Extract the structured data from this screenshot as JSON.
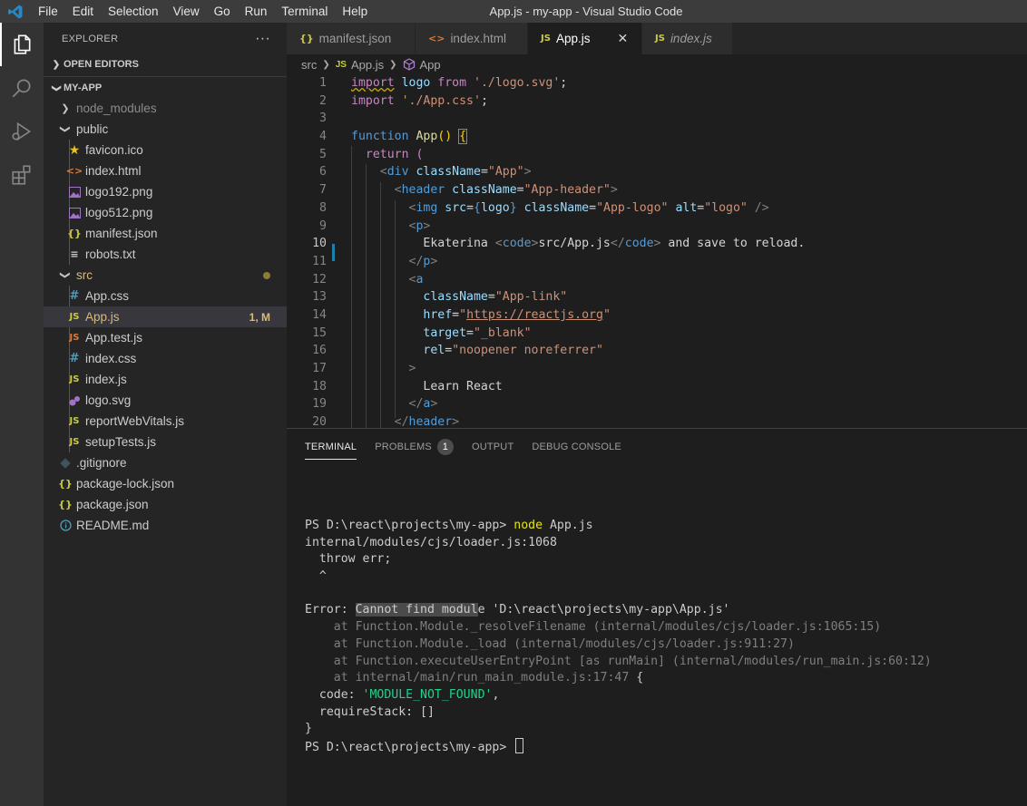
{
  "titlebar": {
    "menu": [
      "File",
      "Edit",
      "Selection",
      "View",
      "Go",
      "Run",
      "Terminal",
      "Help"
    ],
    "window_title": "App.js - my-app - Visual Studio Code"
  },
  "sidebar": {
    "title": "EXPLORER",
    "more": "···",
    "open_editors": "OPEN EDITORS",
    "project": "MY-APP",
    "items": [
      {
        "label": "node_modules",
        "icon": "chevron-right"
      },
      {
        "label": "public",
        "icon": "chevron-down"
      },
      {
        "label": "favicon.ico",
        "icon": "star-icon"
      },
      {
        "label": "index.html",
        "icon": "html-icon"
      },
      {
        "label": "logo192.png",
        "icon": "image-icon"
      },
      {
        "label": "logo512.png",
        "icon": "image-icon"
      },
      {
        "label": "manifest.json",
        "icon": "json-icon"
      },
      {
        "label": "robots.txt",
        "icon": "text-icon"
      },
      {
        "label": "src",
        "icon": "chevron-down"
      },
      {
        "label": "App.css",
        "icon": "css-icon"
      },
      {
        "label": "App.js",
        "icon": "js-icon",
        "badge": "1, M"
      },
      {
        "label": "App.test.js",
        "icon": "js-icon"
      },
      {
        "label": "index.css",
        "icon": "css-icon"
      },
      {
        "label": "index.js",
        "icon": "js-icon"
      },
      {
        "label": "logo.svg",
        "icon": "svg-icon"
      },
      {
        "label": "reportWebVitals.js",
        "icon": "js-icon"
      },
      {
        "label": "setupTests.js",
        "icon": "js-icon"
      },
      {
        "label": ".gitignore",
        "icon": "git-icon"
      },
      {
        "label": "package-lock.json",
        "icon": "json-icon"
      },
      {
        "label": "package.json",
        "icon": "json-icon"
      },
      {
        "label": "README.md",
        "icon": "info-icon"
      }
    ]
  },
  "tabs": [
    {
      "label": "manifest.json",
      "icon": "{}"
    },
    {
      "label": "index.html",
      "icon": "<>"
    },
    {
      "label": "App.js",
      "icon": "JS",
      "close": "✕"
    },
    {
      "label": "index.js",
      "icon": "JS"
    }
  ],
  "breadcrumb": {
    "folder": "src",
    "file": "App.js",
    "symbol": "App"
  },
  "code": {
    "line_numbers": [
      "1",
      "2",
      "3",
      "4",
      "5",
      "6",
      "7",
      "8",
      "9",
      "10",
      "11",
      "12",
      "13",
      "14",
      "15",
      "16",
      "17",
      "18",
      "19",
      "20"
    ],
    "l1": {
      "a": "import",
      "b": " ",
      "c": "logo",
      "d": " from ",
      "e": "'./logo.svg'",
      "f": ";"
    },
    "l2": {
      "a": "import",
      "b": " ",
      "c": "'./App.css'",
      "d": ";"
    },
    "l4": {
      "a": "function",
      "b": " ",
      "c": "App",
      "d": "()",
      "e": " ",
      "f": "{"
    },
    "l5": {
      "a": "  return",
      "b": " ("
    },
    "l6": {
      "a": "    <",
      "b": "div",
      "c": " ",
      "d": "className",
      "e": "=",
      "f": "\"App\"",
      "g": ">"
    },
    "l7": {
      "a": "      <",
      "b": "header",
      "c": " ",
      "d": "className",
      "e": "=",
      "f": "\"App-header\"",
      "g": ">"
    },
    "l8": {
      "a": "        <",
      "b": "img",
      "c": " ",
      "d": "src",
      "e": "=",
      "f": "{",
      "g": "logo",
      "h": "}",
      "i": " ",
      "j": "className",
      "k": "=",
      "l": "\"App-logo\"",
      "m": " ",
      "n": "alt",
      "o": "=",
      "p": "\"logo\"",
      "q": " />"
    },
    "l9": {
      "a": "        <",
      "b": "p",
      "c": ">"
    },
    "l10": {
      "a": "          Ekaterina ",
      "b": "<",
      "c": "code",
      "d": ">",
      "e": "src/App.js",
      "f": "</",
      "g": "code",
      "h": ">",
      "i": " and save to reload."
    },
    "l11": {
      "a": "        </",
      "b": "p",
      "c": ">"
    },
    "l12": {
      "a": "        <",
      "b": "a"
    },
    "l13": {
      "a": "          ",
      "b": "className",
      "c": "=",
      "d": "\"App-link\""
    },
    "l14": {
      "a": "          ",
      "b": "href",
      "c": "=",
      "d": "\"",
      "e": "https://reactjs.org",
      "f": "\""
    },
    "l15": {
      "a": "          ",
      "b": "target",
      "c": "=",
      "d": "\"_blank\""
    },
    "l16": {
      "a": "          ",
      "b": "rel",
      "c": "=",
      "d": "\"noopener noreferrer\""
    },
    "l17": {
      "a": "        >"
    },
    "l18": {
      "a": "          Learn React"
    },
    "l19": {
      "a": "        </",
      "b": "a",
      "c": ">"
    },
    "l20": {
      "a": "      </",
      "b": "header",
      "c": ">"
    }
  },
  "panel": {
    "tabs": [
      "TERMINAL",
      "PROBLEMS",
      "OUTPUT",
      "DEBUG CONSOLE"
    ],
    "problems_count": "1"
  },
  "terminal": {
    "prompt": "PS D:\\react\\projects\\my-app> ",
    "cmd_name": "node",
    "cmd_arg": " App.js",
    "loader": "internal/modules/cjs/loader.js:1068",
    "throw": "  throw err;",
    "caret": "  ^",
    "err_a": "Error: ",
    "err_hl": "Cannot find modul",
    "err_b": "e 'D:\\react\\projects\\my-app\\App.js'",
    "stack1": "    at Function.Module._resolveFilename (internal/modules/cjs/loader.js:1065:15)",
    "stack2": "    at Function.Module._load (internal/modules/cjs/loader.js:911:27)",
    "stack3": "    at Function.executeUserEntryPoint [as runMain] (internal/modules/run_main.js:60:12)",
    "stack4a": "    at internal/main/run_main_module.js:17:47",
    "stack4b": " {",
    "code_key": "  code: ",
    "code_val": "'MODULE_NOT_FOUND'",
    "code_end": ",",
    "require": "  requireStack: []",
    "close": "}",
    "prompt2": "PS D:\\react\\projects\\my-app> "
  },
  "colors": {
    "accent": "#007acc",
    "js": "#cbcb41",
    "css": "#519aba",
    "html": "#e37933",
    "json": "#cbcb41"
  }
}
